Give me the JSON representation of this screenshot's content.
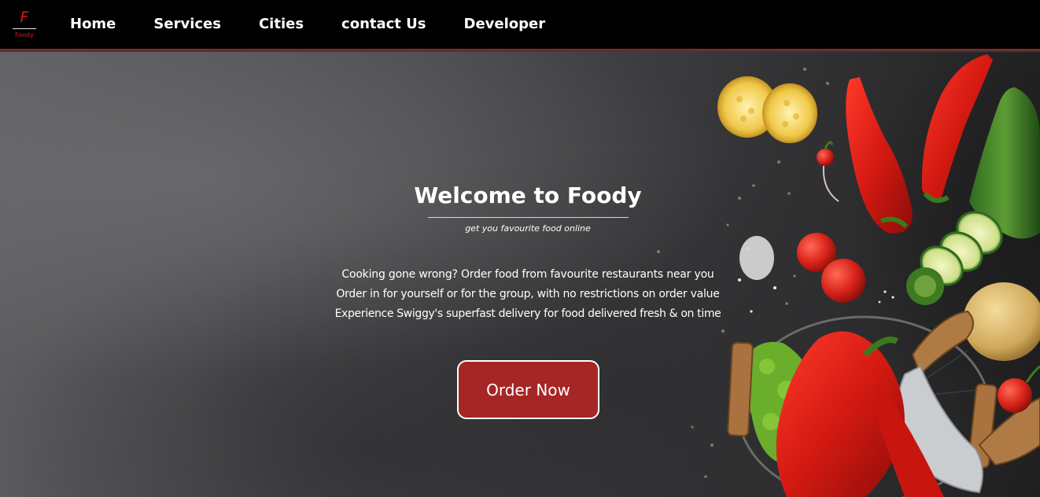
{
  "brand": {
    "logo_letter": "F",
    "logo_word": "Foody",
    "accent_color": "#e01818",
    "button_color": "#a62525"
  },
  "nav": {
    "items": [
      {
        "label": "Home"
      },
      {
        "label": "Services"
      },
      {
        "label": "Cities"
      },
      {
        "label": "contact Us"
      },
      {
        "label": "Developer"
      }
    ]
  },
  "hero": {
    "title": "Welcome to Foody",
    "subtitle": "get you favourite food online",
    "lines": [
      "Cooking gone wrong? Order food from favourite restaurants near you",
      "Order in for yourself or for the group, with no restrictions on order value",
      "Experience Swiggy's superfast delivery for food delivered fresh & on time"
    ],
    "cta_label": "Order Now"
  }
}
